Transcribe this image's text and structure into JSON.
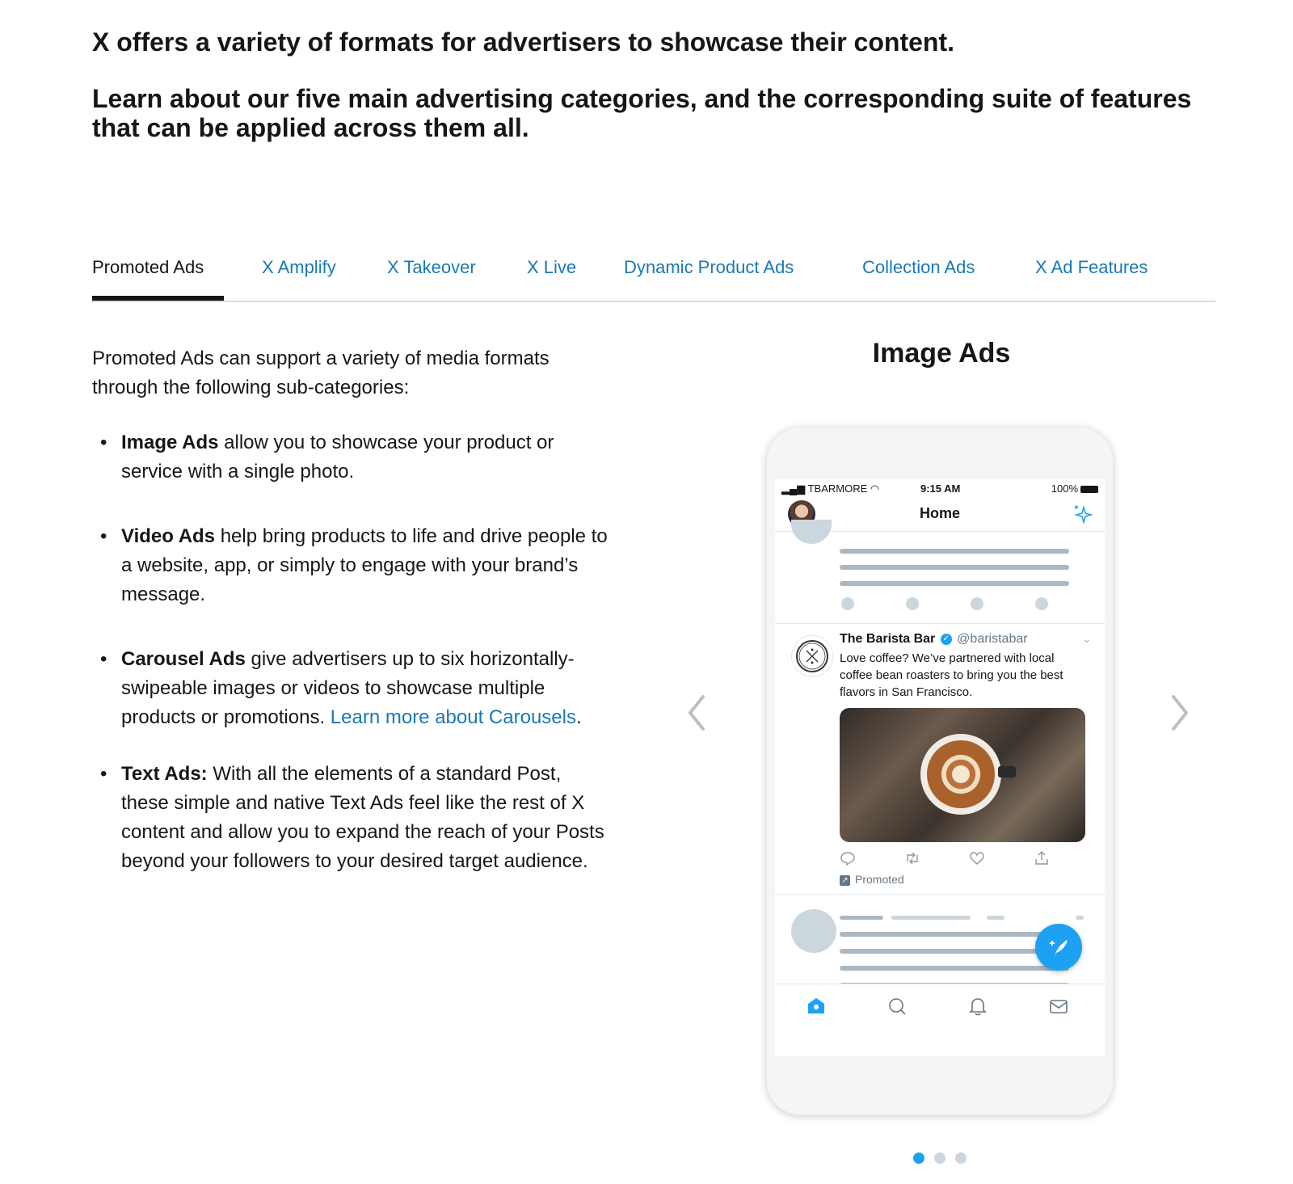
{
  "header": {
    "title": "X offers a variety of formats for advertisers to showcase their content.",
    "subtitle": "Learn about our five main advertising categories, and the corresponding suite of features that can be applied across them all."
  },
  "tabs": [
    {
      "label": "Promoted Ads",
      "active": true
    },
    {
      "label": "X Amplify",
      "active": false
    },
    {
      "label": "X Takeover",
      "active": false
    },
    {
      "label": "X Live",
      "active": false
    },
    {
      "label": "Dynamic Product Ads",
      "active": false
    },
    {
      "label": "Collection Ads",
      "active": false
    },
    {
      "label": "X Ad Features",
      "active": false
    }
  ],
  "content": {
    "intro": "Promoted Ads can support a variety of media formats through the following sub-categories:",
    "bullets": [
      {
        "bold": "Image Ads",
        "text": " allow you to showcase your product or service with a single photo."
      },
      {
        "bold": "Video Ads",
        "text": " help bring products to life and drive people to a website, app, or simply to engage with your brand’s message."
      },
      {
        "bold": "Carousel Ads",
        "text": " give advertisers up to six horizontally-swipeable images or videos to showcase multiple products or promotions. ",
        "link": "Learn more about Carousels",
        "after_link": "."
      },
      {
        "bold": "Text Ads:",
        "text": " With all the elements of a standard Post, these simple and native Text Ads feel like the rest of X content and allow you to expand the reach of your Posts beyond your followers to your desired target audience."
      }
    ]
  },
  "carousel": {
    "title": "Image Ads",
    "prev_icon": "chevron-left-icon",
    "next_icon": "chevron-right-icon",
    "slide_count": 3,
    "active_slide": 1
  },
  "phone": {
    "status": {
      "carrier": "TBARMORE",
      "time": "9:15 AM",
      "battery": "100%"
    },
    "nav_title": "Home",
    "tweet": {
      "name": "The Barista Bar",
      "handle": "@baristabar",
      "body": "Love coffee? We’ve partnered with local coffee bean roasters to bring you the best flavors in San Francisco.",
      "promoted_label": "Promoted"
    }
  },
  "colors": {
    "link": "#1a78b4",
    "twitter_blue": "#1da1f2",
    "text": "#14171a",
    "skeleton": "#aab8c2"
  }
}
